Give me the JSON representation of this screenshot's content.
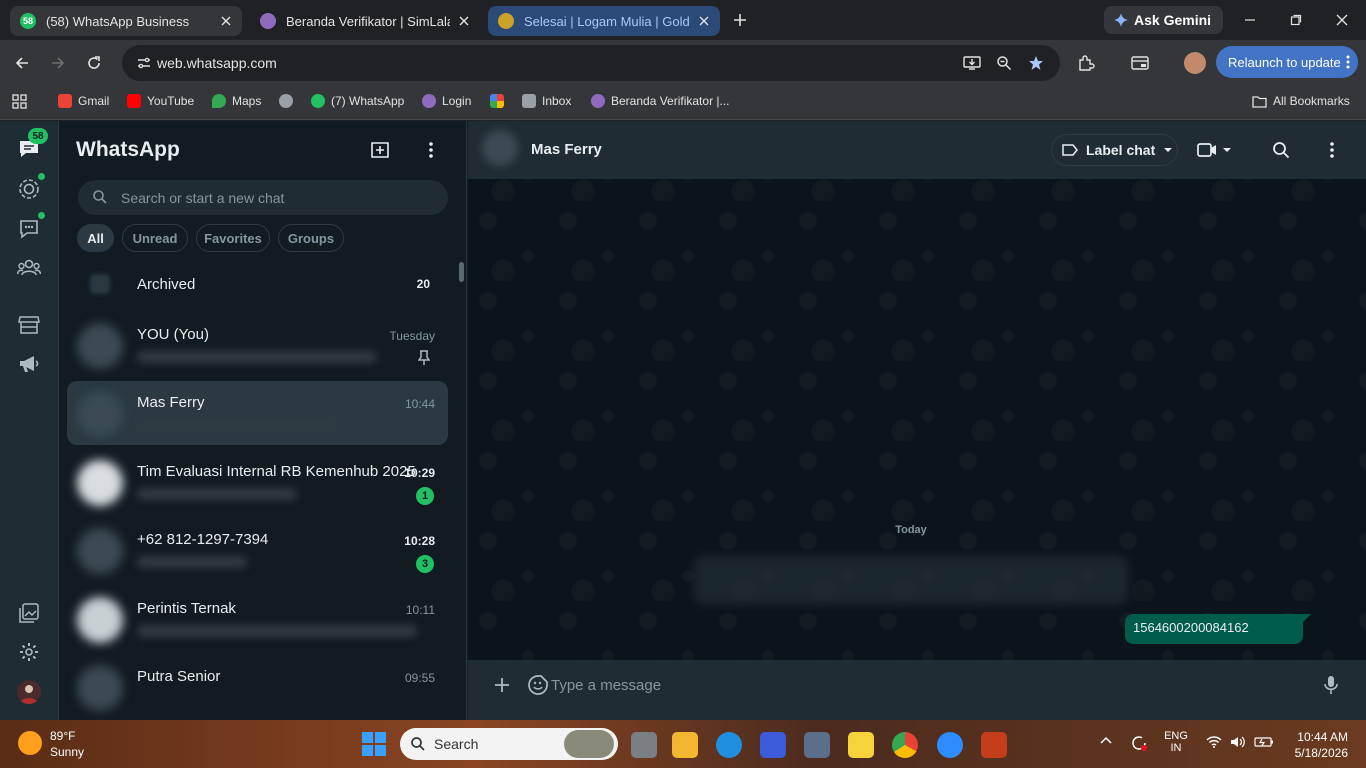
{
  "browser": {
    "tabs": [
      {
        "title": "(58) WhatsApp Business",
        "favicon_badge": "58"
      },
      {
        "title": "Beranda Verifikator | SimLala"
      },
      {
        "title": "Selesai | Logam Mulia | Gold, Si"
      }
    ],
    "ask_gemini": "Ask Gemini",
    "url": "web.whatsapp.com",
    "relaunch": "Relaunch to update",
    "bookmarks": [
      "Gmail",
      "YouTube",
      "Maps",
      "(7) WhatsApp",
      "Login",
      "Inbox",
      "Beranda Verifikator |..."
    ],
    "all_bookmarks": "All Bookmarks"
  },
  "whatsapp": {
    "title": "WhatsApp",
    "rail_badge": "58",
    "search_placeholder": "Search or start a new chat",
    "filters": [
      "All",
      "Unread",
      "Favorites",
      "Groups"
    ],
    "archived": {
      "label": "Archived",
      "count": "20"
    },
    "chats": [
      {
        "name": "YOU (You)",
        "time": "Tuesday",
        "pinned": true
      },
      {
        "name": "Mas Ferry",
        "time": "10:44",
        "selected": true
      },
      {
        "name": "Tim Evaluasi Internal RB Kemenhub 2025",
        "time": "10:29",
        "unread": "1"
      },
      {
        "name": "+62 812-1297-7394",
        "time": "10:28",
        "unread": "3"
      },
      {
        "name": "Perintis Ternak",
        "time": "10:11"
      },
      {
        "name": "Putra Senior",
        "time": "09:55"
      }
    ],
    "conversation": {
      "name": "Mas Ferry",
      "label_chat": "Label chat",
      "date_divider": "Today",
      "outgoing_message": "1564600200084162",
      "composer_placeholder": "Type a message"
    }
  },
  "taskbar": {
    "weather_temp": "89°F",
    "weather_desc": "Sunny",
    "search": "Search",
    "lang_top": "ENG",
    "lang_bottom": "IN",
    "time": "10:44 AM",
    "date": "5/18/2026"
  },
  "colors": {
    "wa_green": "#21c063",
    "outgoing_bubble": "#005c4b",
    "panel": "#202c33",
    "background": "#111b21",
    "chrome_accent": "#4273c4"
  }
}
